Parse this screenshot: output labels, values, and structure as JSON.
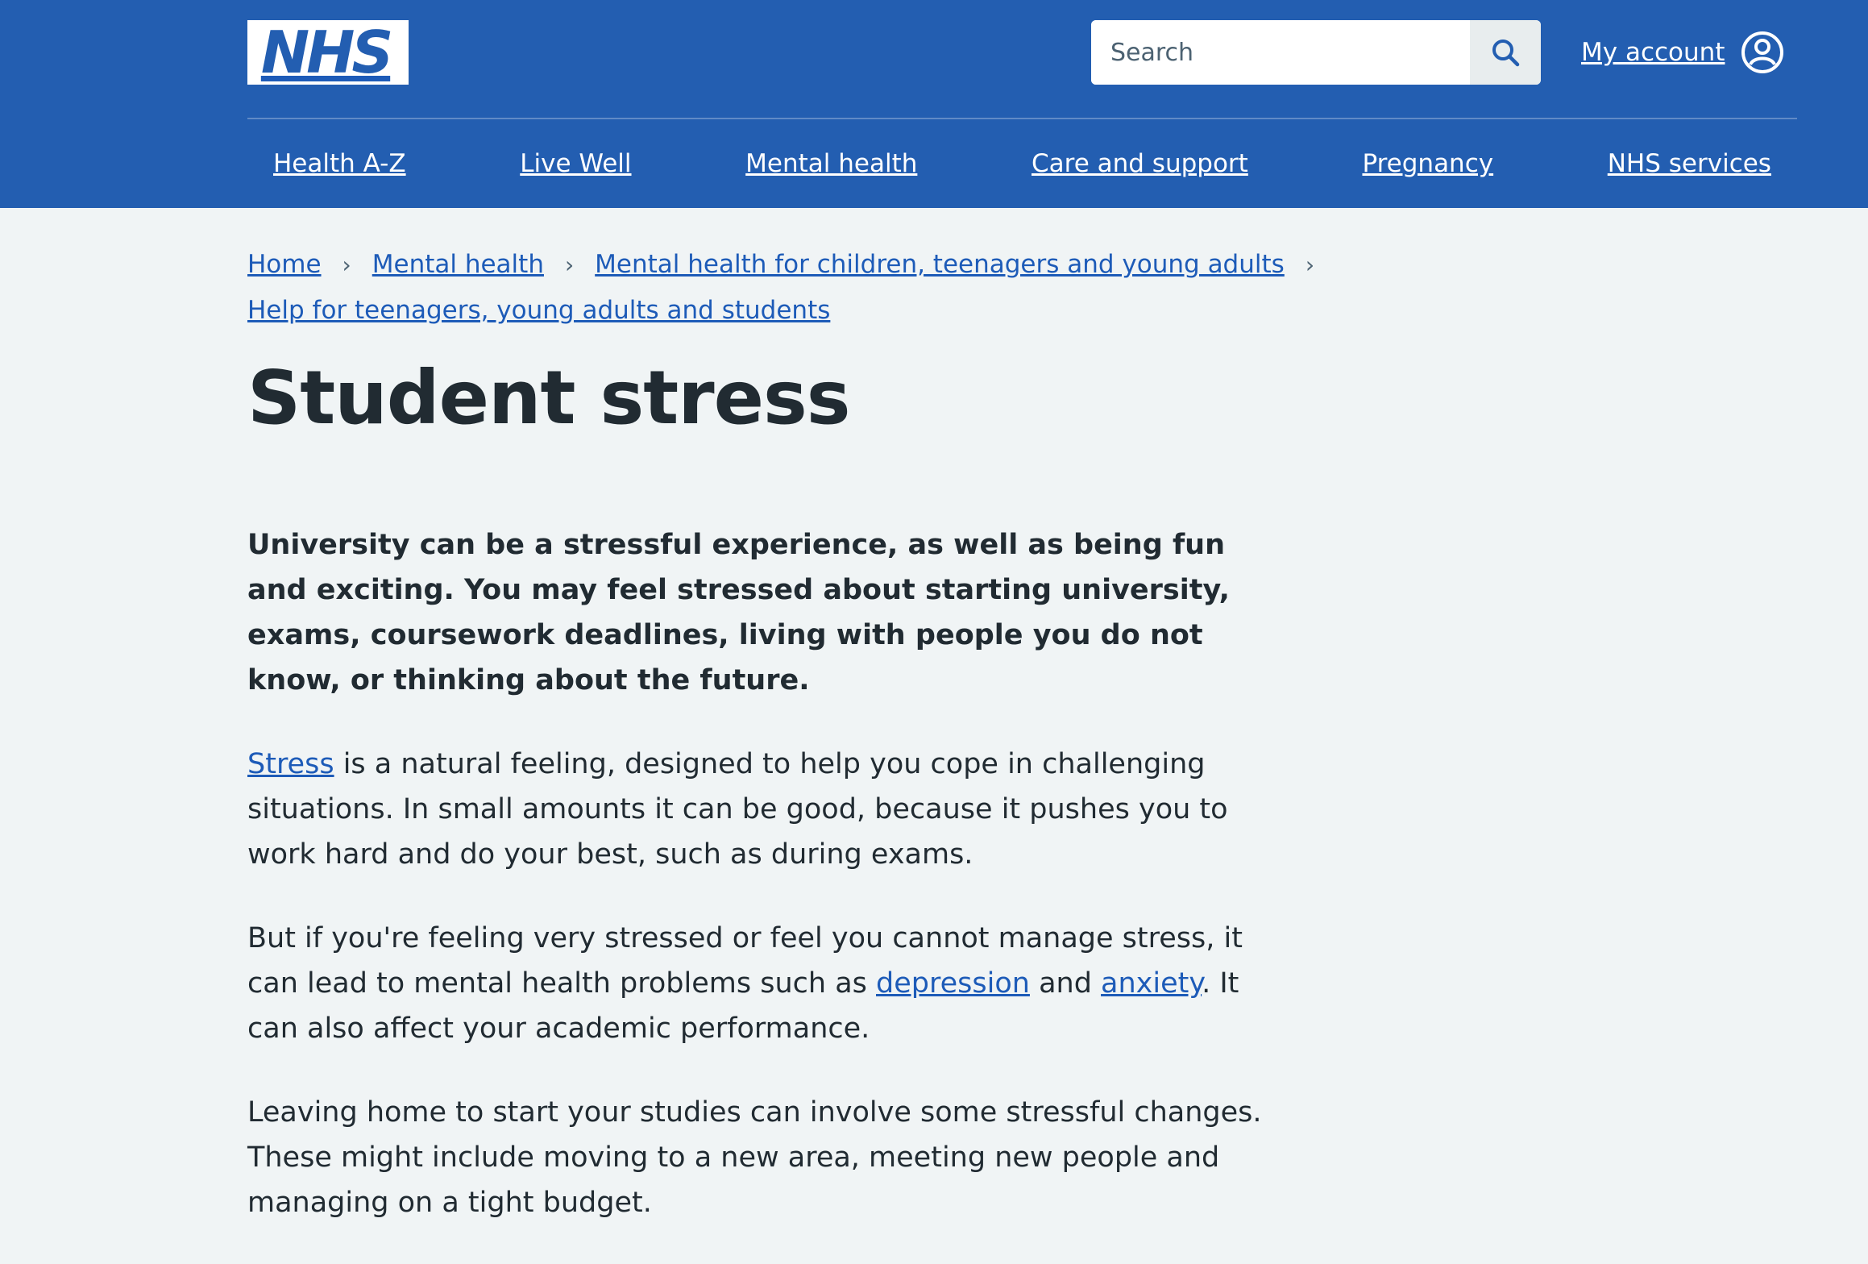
{
  "header": {
    "logo_text": "NHS",
    "search": {
      "placeholder": "Search"
    },
    "account_label": "My account"
  },
  "nav": {
    "items": [
      {
        "label": "Health A-Z"
      },
      {
        "label": "Live Well"
      },
      {
        "label": "Mental health"
      },
      {
        "label": "Care and support"
      },
      {
        "label": "Pregnancy"
      },
      {
        "label": "NHS services"
      }
    ]
  },
  "breadcrumb": {
    "items": [
      {
        "label": "Home"
      },
      {
        "label": "Mental health"
      },
      {
        "label": "Mental health for children, teenagers and young adults"
      },
      {
        "label": "Help for teenagers, young adults and students"
      }
    ],
    "separator": "›"
  },
  "page": {
    "title": "Student stress",
    "lede": "University can be a stressful experience, as well as being fun and exciting. You may feel stressed about starting university, exams, coursework deadlines, living with people you do not know, or thinking about the future.",
    "p1": {
      "link_stress": "Stress",
      "text": " is a natural feeling, designed to help you cope in challenging situations. In small amounts it can be good, because it pushes you to work hard and do your best, such as during exams."
    },
    "p2": {
      "text_before": "But if you're feeling very stressed or feel you cannot manage stress, it can lead to mental health problems such as ",
      "link_depression": "depression",
      "text_and": " and ",
      "link_anxiety": "anxiety",
      "text_after": ". It can also affect your academic performance."
    },
    "p3": "Leaving home to start your studies can involve some stressful changes. These might include moving to a new area, meeting new people and managing on a tight budget."
  },
  "colors": {
    "header_bg": "#235eb1",
    "page_bg": "#f0f4f5",
    "link": "#1d5bb8",
    "text": "#212b32"
  },
  "icons": {
    "search": "search-icon",
    "account": "user-circle-icon",
    "breadcrumb_separator": "chevron-right-icon"
  }
}
